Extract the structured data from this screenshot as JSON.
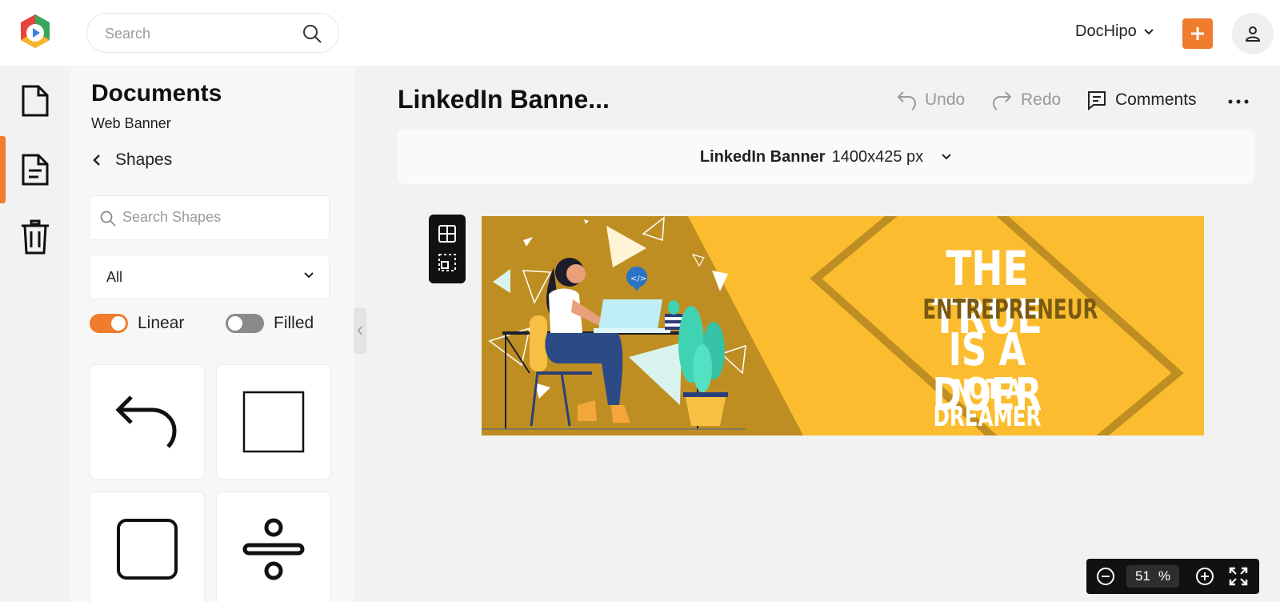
{
  "header": {
    "search_placeholder": "Search",
    "account_name": "DocHipo",
    "accent_color": "#f07c2e"
  },
  "rail": {
    "items": [
      "document-icon",
      "file-text-icon",
      "trash-icon"
    ],
    "active_index": 1
  },
  "panel": {
    "title": "Documents",
    "subtitle": "Web Banner",
    "section": "Shapes",
    "search_placeholder": "Search Shapes",
    "filter_value": "All",
    "toggle_linear": {
      "label": "Linear",
      "on": true
    },
    "toggle_filled": {
      "label": "Filled",
      "on": false
    },
    "shapes": [
      "undo-arrow-icon",
      "square-icon",
      "rounded-square-icon",
      "divide-icon"
    ]
  },
  "editor": {
    "doc_title": "LinkedIn Banne...",
    "undo_label": "Undo",
    "redo_label": "Redo",
    "comments_label": "Comments",
    "size_name": "LinkedIn Banner",
    "size_dims": "1400x425 px"
  },
  "banner": {
    "line1": "THE TRUE",
    "line2": "ENTREPRENEUR",
    "line3": "IS A DOER",
    "line4": "NOT A DREAMER",
    "colors": {
      "background": "#fbbd2f",
      "dark": "#bf8e22",
      "white": "#ffffff"
    }
  },
  "zoom": {
    "value": "51",
    "unit": "%"
  }
}
